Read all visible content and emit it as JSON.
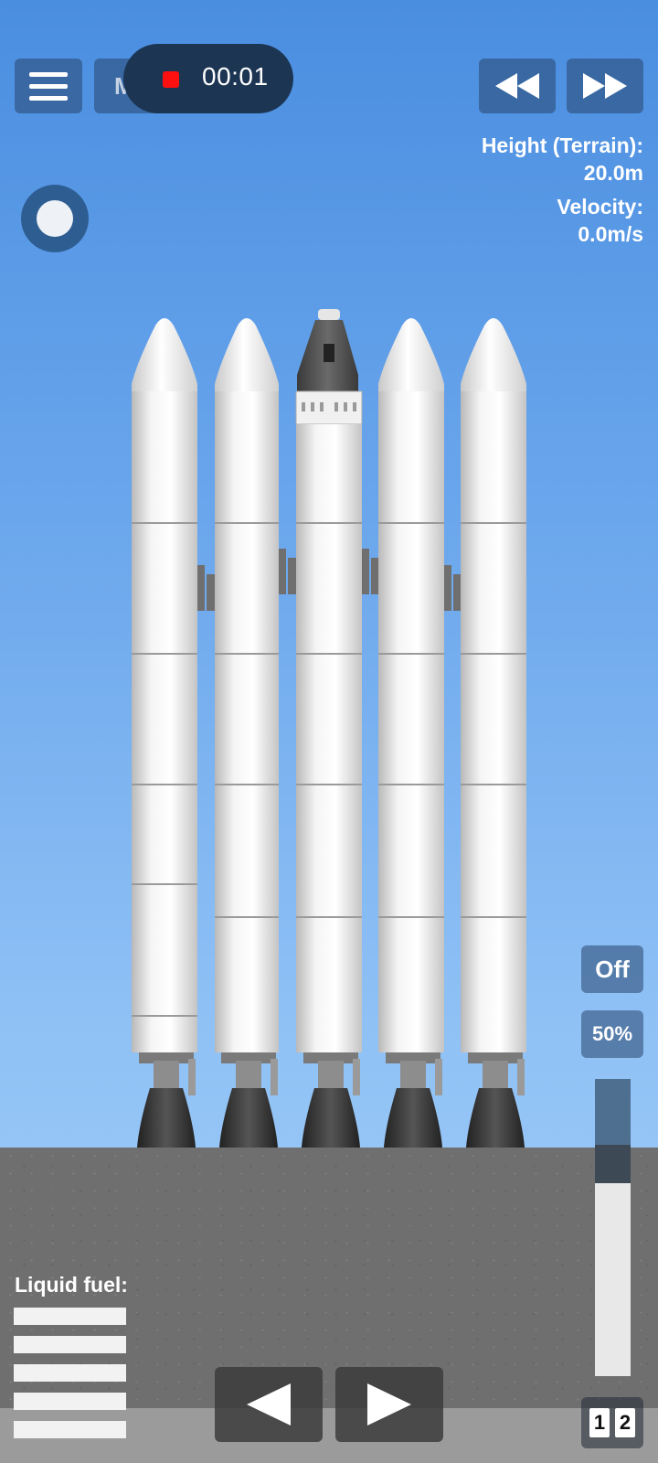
{
  "toolbar": {
    "menu_icon": "hamburger-menu-icon",
    "map_label": "Map",
    "rewind_icon": "rewind-icon",
    "fast_forward_icon": "fast-forward-icon"
  },
  "recording": {
    "time": "00:01",
    "indicator_color": "#ff1010"
  },
  "telemetry": {
    "height_label": "Height (Terrain):",
    "height_value": "20.0m",
    "velocity_label": "Velocity:",
    "velocity_value": "0.0m/s"
  },
  "controls": {
    "off_label": "Off",
    "percent_label": "50%",
    "throttle_fraction": 0.65,
    "stages": [
      "1",
      "2"
    ]
  },
  "fuel": {
    "label": "Liquid fuel:",
    "bar_count": 5
  },
  "colors": {
    "sky_top": "#4a8ee0",
    "ground": "#6f6f6f",
    "button_bg": "rgba(40,70,110,0.55)"
  },
  "rockets": {
    "count": 5,
    "capsule_on_center": true
  }
}
